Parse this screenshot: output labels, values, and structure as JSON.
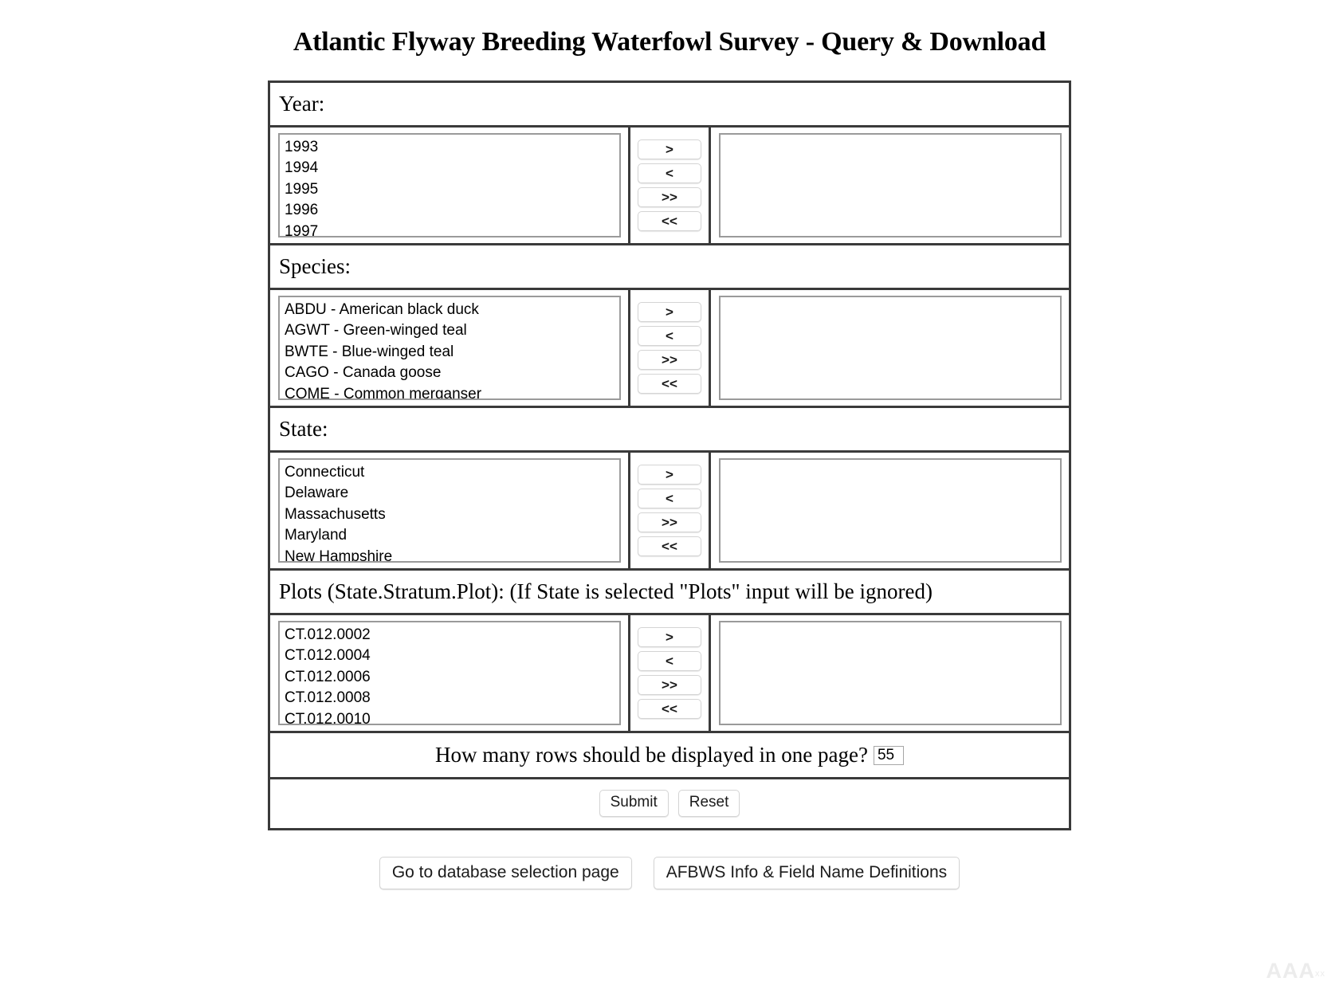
{
  "page": {
    "title": "Atlantic Flyway Breeding Waterfowl Survey - Query & Download",
    "watermark": "AAA",
    "watermark_small": "xx"
  },
  "transfer_buttons": {
    "add_one": ">",
    "remove_one": "<",
    "add_all": ">>",
    "remove_all": "<<"
  },
  "sections": [
    {
      "key": "year",
      "label": "Year:",
      "available": [
        "1993",
        "1994",
        "1995",
        "1996",
        "1997"
      ],
      "selected": []
    },
    {
      "key": "species",
      "label": "Species:",
      "available": [
        "ABDU - American black duck",
        "AGWT - Green-winged teal",
        "BWTE - Blue-winged teal",
        "CAGO - Canada goose",
        "COME - Common merganser"
      ],
      "selected": []
    },
    {
      "key": "state",
      "label": "State:",
      "available": [
        "Connecticut",
        "Delaware",
        "Massachusetts",
        "Maryland",
        "New Hampshire"
      ],
      "selected": []
    },
    {
      "key": "plots",
      "label": "Plots (State.Stratum.Plot): (If State is selected \"Plots\" input will be ignored)",
      "available": [
        "CT.012.0002",
        "CT.012.0004",
        "CT.012.0006",
        "CT.012.0008",
        "CT.012.0010"
      ],
      "selected": []
    }
  ],
  "rows_per_page": {
    "label": "How many rows should be displayed in one page?",
    "value": "55"
  },
  "form_actions": {
    "submit": "Submit",
    "reset": "Reset"
  },
  "footer_actions": {
    "database_selection": "Go to database selection page",
    "info_definitions": "AFBWS Info & Field Name Definitions"
  }
}
